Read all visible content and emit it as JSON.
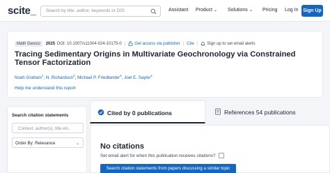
{
  "nav": {
    "logo": "scite_",
    "search_placeholder": "Search by title, author, keywords or DOI",
    "assistant": "Assistant",
    "product": "Product",
    "solutions": "Solutions",
    "pricing": "Pricing",
    "login": "Log In",
    "signup": "Sign Up"
  },
  "paper": {
    "journal_chip": "Math Geosci",
    "year": "2025",
    "doi": "DOI: 10.1007/s11004-024-10175-0",
    "access_link": "Get access via publisher",
    "cite": "Cite",
    "alert_link": "Sign up to set email alerts",
    "title": "Tracing Sedimentary Origins in Multivariate Geochronology via Constrained Tensor Factorization",
    "authors": [
      {
        "name": "Noah Graham",
        "sup": "1"
      },
      {
        "name": "N. Richardson",
        "sup": "2"
      },
      {
        "name": "Michael P. Friedlander",
        "sup": "3"
      },
      {
        "name": "Joel E. Saylor",
        "sup": "4"
      }
    ],
    "help": "Help me understand this report"
  },
  "sidebar": {
    "title": "Search citation statements",
    "input_placeholder": "Context, author(s), title etc.",
    "order_by": "Order By: Relevance"
  },
  "tabs": {
    "cited_by": "Cited by 0 publications",
    "references": "References 54 publications"
  },
  "content": {
    "no_citations": "No citations",
    "email_alert": "Set email alert for when this publication receives citations?",
    "search_button": "Search citation statements from papers discussing a similar topic"
  },
  "colors": {
    "accent": "#1466c4",
    "text": "#1d2433",
    "background": "#f3f5f8"
  },
  "icons": [
    "search-icon",
    "unlock-icon",
    "bell-icon",
    "cited-by-icon",
    "references-icon",
    "chevron-down-icon"
  ]
}
